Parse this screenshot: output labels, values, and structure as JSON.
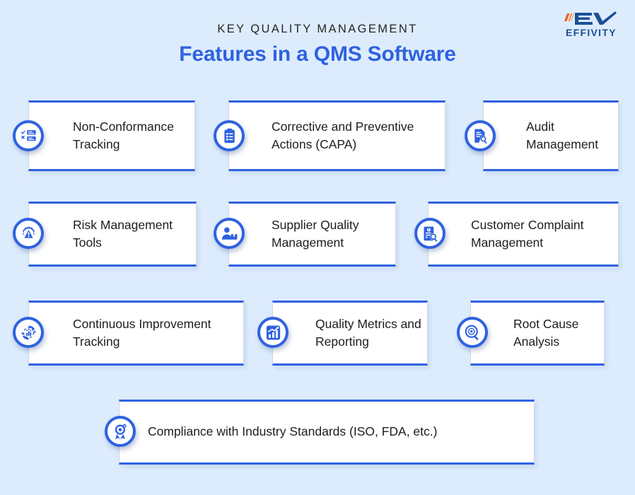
{
  "header": {
    "eyebrow": "KEY QUALITY MANAGEMENT",
    "headline": "Features in a QMS Software",
    "eyebrow_color": "#242424",
    "headline_color": "#2f62e0"
  },
  "logo": {
    "monogram": "EV",
    "wordmark": "EFFIVITY",
    "mark_color": "#1c4f96",
    "accent_color": "#e8622a"
  },
  "theme": {
    "background": "#ddecfd",
    "card_background": "#ffffff",
    "accent": "#2f62e0",
    "card_border": "#d2d6dd",
    "text": "#1d1d1d"
  },
  "cards": [
    {
      "label": "Non-Conformance Tracking",
      "icon": "checklist-icon"
    },
    {
      "label": "Corrective and Preventive Actions (CAPA)",
      "icon": "clipboard-icon"
    },
    {
      "label": "Audit Management",
      "icon": "document-search-icon"
    },
    {
      "label": "Risk Management Tools",
      "icon": "gear-warning-icon"
    },
    {
      "label": "Supplier Quality Management",
      "icon": "supplier-person-box-icon"
    },
    {
      "label": "Customer Complaint Management",
      "icon": "complaint-search-icon"
    },
    {
      "label": "Continuous Improvement Tracking",
      "icon": "cycle-chart-icon"
    },
    {
      "label": "Quality Metrics and Reporting",
      "icon": "bar-chart-trend-icon"
    },
    {
      "label": "Root Cause Analysis",
      "icon": "magnifier-target-icon"
    },
    {
      "label": "Compliance with Industry Standards (ISO, FDA, etc.)",
      "icon": "award-ribbon-icon"
    }
  ]
}
